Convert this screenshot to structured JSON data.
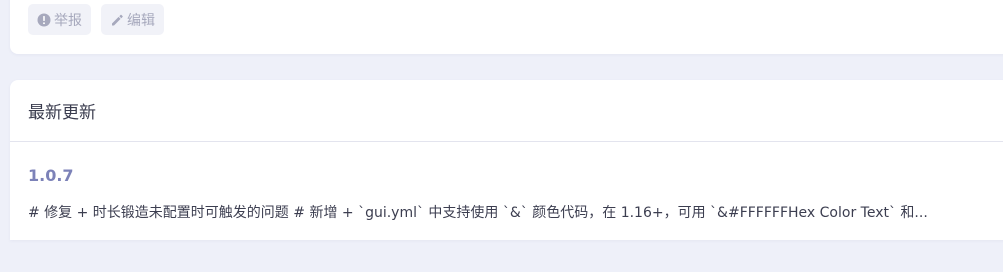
{
  "actions": {
    "report_label": "举报",
    "edit_label": "编辑"
  },
  "updates": {
    "title": "最新更新",
    "version": "1.0.7",
    "changelog": "# 修复 + 时长锻造未配置时可触发的问题 # 新增 + `gui.yml` 中支持使用 `&` 颜色代码，在 1.16+，可用 `&#FFFFFFHex Color Text` 和..."
  },
  "colors": {
    "background": "#eef0f9",
    "card": "#ffffff",
    "button_bg": "#f1f2f8",
    "button_text": "#a7a9bd",
    "version_text": "#7c82b8"
  }
}
